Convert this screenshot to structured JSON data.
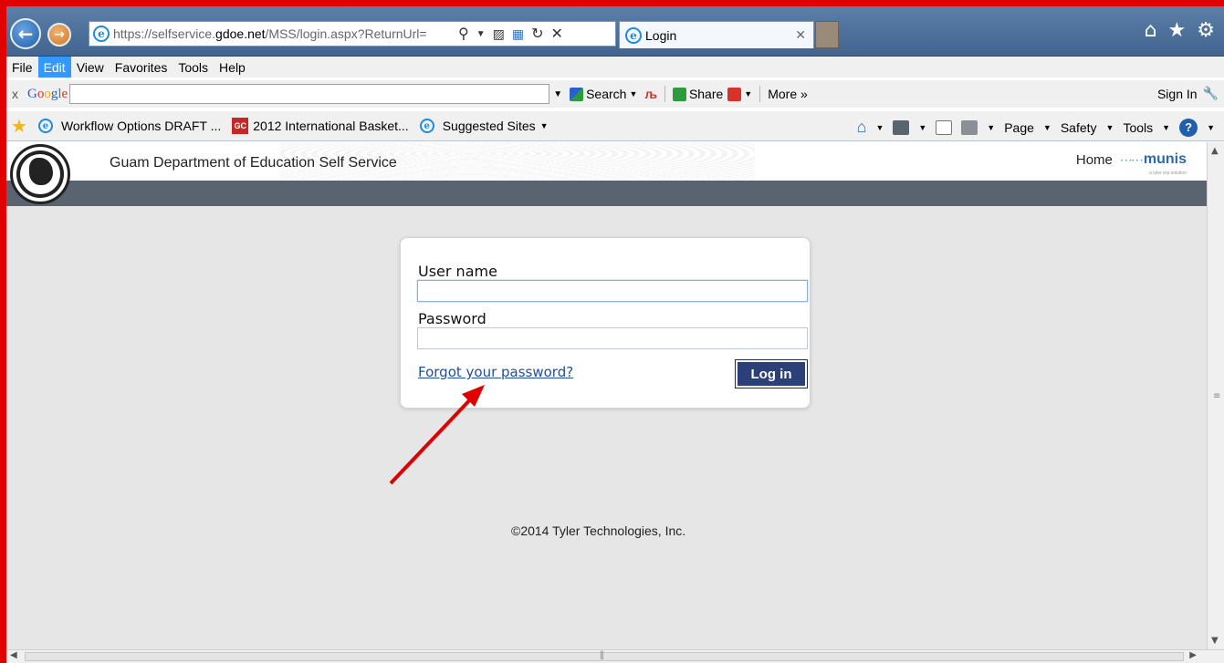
{
  "browser": {
    "url_prefix": "https://selfservice.",
    "url_host": "gdoe.net",
    "url_path": "/MSS/login.aspx?ReturnUrl=",
    "tab_title": "Login"
  },
  "menubar": {
    "items": [
      "File",
      "Edit",
      "View",
      "Favorites",
      "Tools",
      "Help"
    ],
    "active_index": 1
  },
  "google_toolbar": {
    "close": "x",
    "logo": [
      "G",
      "o",
      "o",
      "g",
      "l",
      "e"
    ],
    "search_label": "Search",
    "share_label": "Share",
    "more_label": "More »",
    "sign_in_label": "Sign In"
  },
  "favorites_bar": {
    "items": [
      "Workflow Options DRAFT ...",
      "2012 International Basket...",
      "Suggested Sites"
    ],
    "gc_badge": "GC",
    "page_label": "Page",
    "safety_label": "Safety",
    "tools_label": "Tools"
  },
  "site": {
    "title": "Guam Department of Education Self Service",
    "home_link": "Home",
    "brand": "munis",
    "brand_tagline": "a tyler erp solution"
  },
  "login": {
    "username_label": "User name",
    "username_value": "",
    "password_label": "Password",
    "password_value": "",
    "forgot_link": "Forgot your password?",
    "submit_label": "Log in"
  },
  "footer": {
    "copyright": "©2014 Tyler Technologies, Inc."
  },
  "colors": {
    "frame_red": "#e00000",
    "titlebar_blue": "#4a6d96",
    "nav_strip": "#5a6470",
    "login_button": "#2b3f78",
    "link_blue": "#1f4fa0",
    "annotation_arrow": "#e00000"
  }
}
